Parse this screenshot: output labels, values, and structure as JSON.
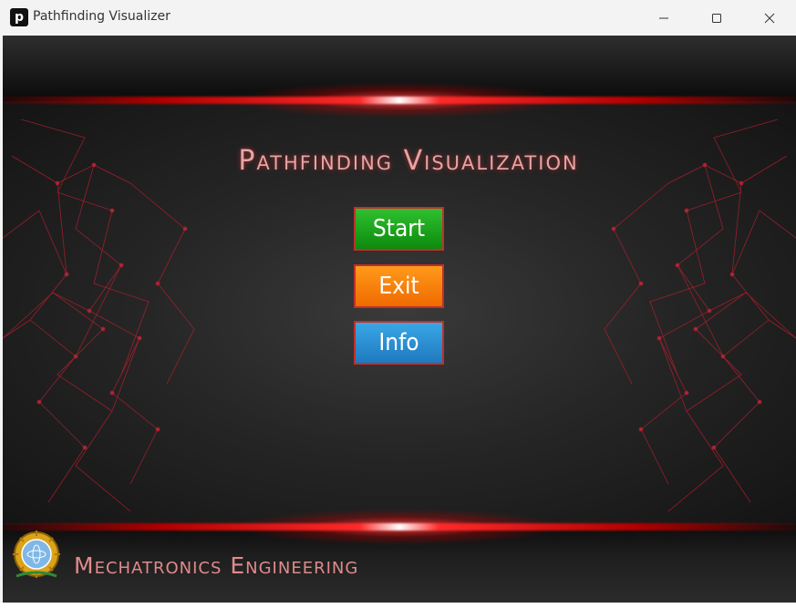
{
  "window": {
    "title": "Pathfinding Visualizer",
    "app_icon_letter": "p"
  },
  "main": {
    "heading": "Pathfinding Visualization",
    "buttons": {
      "start": "Start",
      "exit": "Exit",
      "info": "Info"
    },
    "footer": "Mechatronics Engineering"
  },
  "colors": {
    "start_button": "#13a413",
    "exit_button": "#ff7a00",
    "info_button": "#2b8fd6",
    "accent_red": "#ff2a2a",
    "heading_text": "#e8a3a3"
  }
}
